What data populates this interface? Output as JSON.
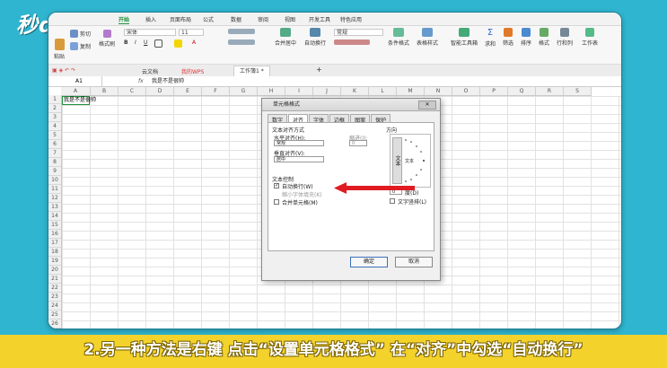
{
  "logo": "秒dong视频",
  "caption": "2.另一种方法是右键 点击“设置单元格格式” 在“对齐”中勾选“自动换行”",
  "menu": [
    "开始",
    "插入",
    "页面布局",
    "公式",
    "数据",
    "审阅",
    "视图",
    "开发工具",
    "特色应用"
  ],
  "ribbon": {
    "paste": "粘贴",
    "cut": "剪切",
    "copy": "复制",
    "format_painter": "格式刷",
    "font": "宋体",
    "size": "11",
    "merge": "合并居中",
    "wrap": "自动换行",
    "number_format": "常规",
    "cond_format": "条件格式",
    "table_style": "表格样式",
    "smart_toolbox": "智能工具箱",
    "sum": "求和",
    "filter": "筛选",
    "sort": "排序",
    "format": "格式",
    "rowcol": "行和列",
    "worksheet": "工作表"
  },
  "tabs": [
    "云文档",
    "我的WPS",
    "工作簿1 *"
  ],
  "formula_bar": {
    "cell_ref": "A1",
    "fx": "fx",
    "value": "我是不是很帅"
  },
  "columns": [
    "A",
    "B",
    "C",
    "D",
    "E",
    "F",
    "G",
    "H",
    "I",
    "J",
    "K",
    "L",
    "M",
    "N",
    "O",
    "P",
    "Q",
    "R",
    "S"
  ],
  "rows": [
    "1",
    "2",
    "3",
    "4",
    "5",
    "6",
    "7",
    "8",
    "9",
    "10",
    "11",
    "12",
    "13",
    "14",
    "15",
    "16",
    "17",
    "18",
    "19",
    "20",
    "21",
    "22",
    "23",
    "24",
    "25",
    "26"
  ],
  "cell_a1": "我是不是很帅",
  "dialog": {
    "title": "单元格格式",
    "tabs": [
      "数字",
      "对齐",
      "字体",
      "边框",
      "图案",
      "保护"
    ],
    "active_tab": "对齐",
    "text_alignment": "文本对齐方式",
    "horizontal": "水平对齐(H):",
    "horizontal_value": "常规",
    "indent": "缩进(I):",
    "indent_value": "0",
    "vertical": "垂直对齐(V):",
    "vertical_value": "居中",
    "text_control": "文本控制",
    "wrap_text": "自动换行(W)",
    "shrink": "缩小字体填充(K)",
    "merge_cells": "合并单元格(M)",
    "orientation": "方向",
    "orient_vertical_text": "文本",
    "orient_text": "文本",
    "degrees_value": "0",
    "degrees": "度(D)",
    "vertical_text": "文字竖排(L)",
    "ok": "确定",
    "cancel": "取消"
  }
}
